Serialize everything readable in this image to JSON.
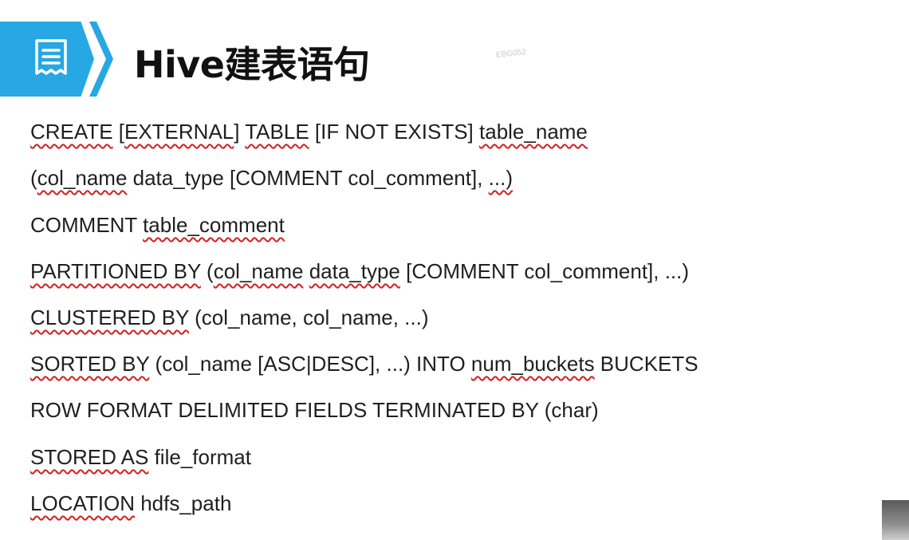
{
  "header": {
    "title": "Hive建表语句",
    "icon": "document-icon",
    "accent_color": "#27a7e3"
  },
  "watermark": "EBG052",
  "lines": [
    {
      "segments": [
        {
          "text": "CREATE",
          "squiggle": true
        },
        {
          "text": " [",
          "squiggle": false
        },
        {
          "text": "EXTERNAL",
          "squiggle": true
        },
        {
          "text": "] ",
          "squiggle": false
        },
        {
          "text": "TABLE",
          "squiggle": true
        },
        {
          "text": " [IF NOT EXISTS] ",
          "squiggle": false
        },
        {
          "text": "table_name",
          "squiggle": true
        }
      ]
    },
    {
      "segments": [
        {
          "text": "(",
          "squiggle": false
        },
        {
          "text": "col_name",
          "squiggle": true
        },
        {
          "text": " data_type [COMMENT col_comment], ",
          "squiggle": false
        },
        {
          "text": "...)",
          "squiggle": true
        }
      ]
    },
    {
      "segments": [
        {
          "text": "COMMENT ",
          "squiggle": false
        },
        {
          "text": "table_comment",
          "squiggle": true
        }
      ]
    },
    {
      "segments": [
        {
          "text": "PARTITIONED BY",
          "squiggle": true
        },
        {
          "text": " (",
          "squiggle": false
        },
        {
          "text": "col_name",
          "squiggle": true
        },
        {
          "text": " ",
          "squiggle": false
        },
        {
          "text": "data_type",
          "squiggle": true
        },
        {
          "text": " [COMMENT col_comment], ...)",
          "squiggle": false
        }
      ]
    },
    {
      "segments": [
        {
          "text": "CLUSTERED BY",
          "squiggle": true
        },
        {
          "text": " (col_name, col_name, ...)",
          "squiggle": false
        }
      ]
    },
    {
      "segments": [
        {
          "text": "SORTED BY",
          "squiggle": true
        },
        {
          "text": " (col_name [ASC|DESC], ...) INTO ",
          "squiggle": false
        },
        {
          "text": "num_buckets",
          "squiggle": true
        },
        {
          "text": " BUCKETS",
          "squiggle": false
        }
      ]
    },
    {
      "segments": [
        {
          "text": "ROW FORMAT DELIMITED FIELDS TERMINATED BY (char)",
          "squiggle": false
        }
      ]
    },
    {
      "segments": [
        {
          "text": "STORED AS",
          "squiggle": true
        },
        {
          "text": " file_format",
          "squiggle": false
        }
      ]
    },
    {
      "segments": [
        {
          "text": "LOCATION",
          "squiggle": true
        },
        {
          "text": " hdfs_path",
          "squiggle": false
        }
      ]
    }
  ]
}
